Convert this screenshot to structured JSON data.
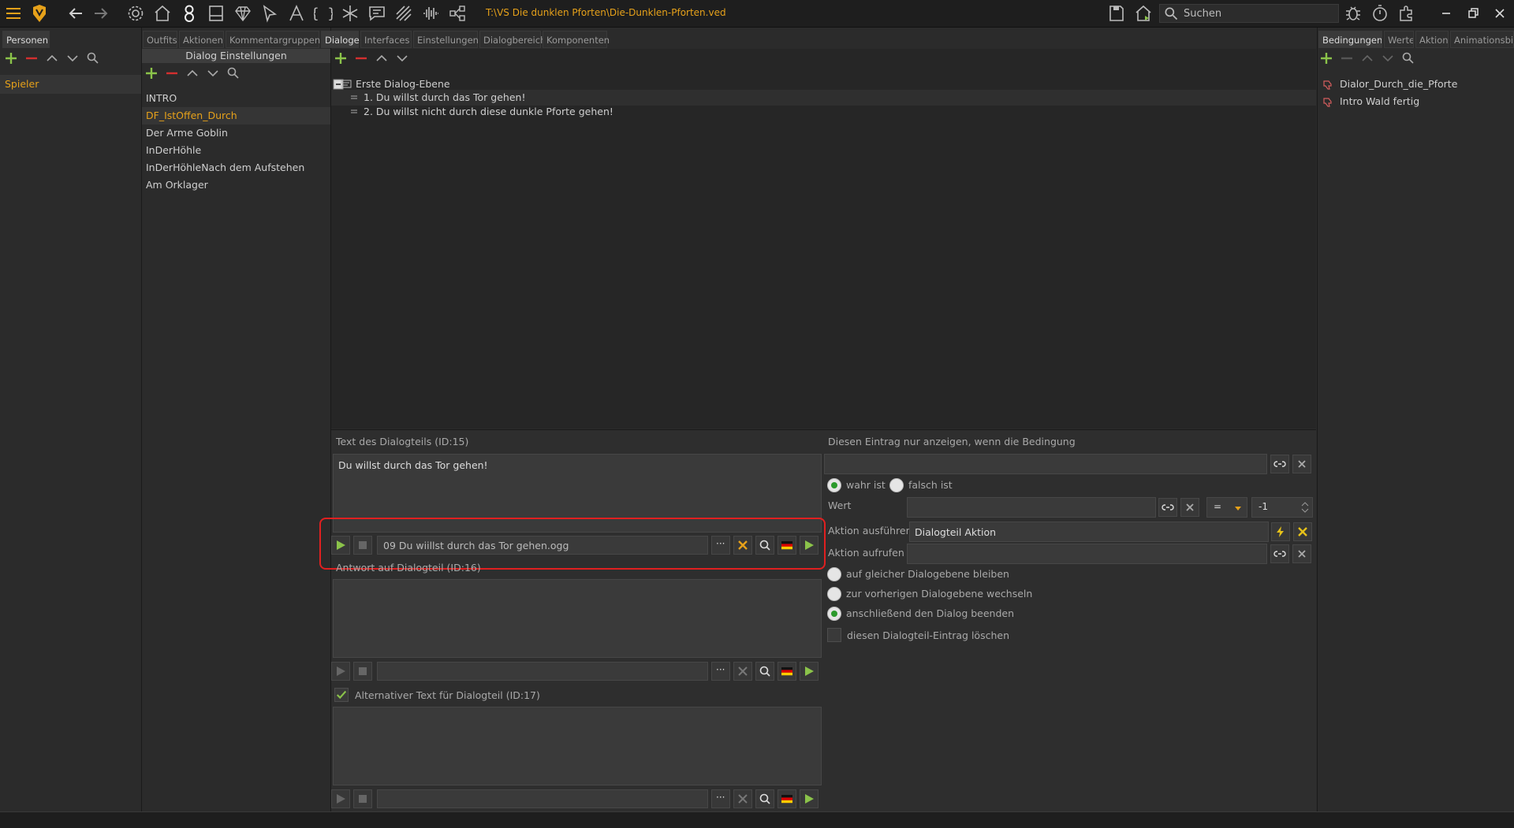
{
  "toolbar": {
    "path": "T:\\VS Die dunklen Pforten\\Die-Dunklen-Pforten.ved",
    "search_placeholder": "Suchen"
  },
  "left_panel": {
    "tab": "Personen",
    "items": [
      "Spieler"
    ]
  },
  "center_tabs": [
    "Outfits",
    "Aktionen",
    "Kommentargruppen",
    "Dialoge",
    "Interfaces",
    "Einstellungen",
    "Dialogbereich",
    "Komponenten"
  ],
  "active_center_tab": "Dialoge",
  "dialog_list": {
    "header": "Dialog Einstellungen",
    "items": [
      "INTRO",
      "DF_IstOffen_Durch",
      "Der Arme Goblin",
      "InDerHöhle",
      "InDerHöhleNach dem Aufstehen",
      "Am Orklager"
    ],
    "selected_index": 1
  },
  "tree": {
    "root": "Erste Dialog-Ebene",
    "children": [
      "1. Du willst durch das Tor gehen!",
      "2. Du willst nicht durch diese dunkle Pforte gehen!"
    ]
  },
  "editor": {
    "text_label": "Text des Dialogteils (ID:15)",
    "text_value": "Du willst durch das Tor gehen!",
    "audio_file": "09 Du wiillst durch das Tor gehen.ogg",
    "answer_label": "Antwort auf Dialogteil (ID:16)",
    "alt_label": "Alternativer Text für Dialogteil (ID:17)",
    "ellipsis": "···"
  },
  "condition": {
    "header": "Diesen Eintrag nur anzeigen, wenn die Bedingung",
    "true_label": "wahr ist",
    "false_label": "falsch ist",
    "value_label": "Wert",
    "operator": "=",
    "number": "-1",
    "execute_label": "Aktion ausführen",
    "execute_value": "Dialogteil Aktion",
    "call_label": "Aktion aufrufen",
    "options": [
      "auf gleicher Dialogebene bleiben",
      "zur vorherigen Dialogebene wechseln",
      "anschließend den Dialog beenden"
    ],
    "selected_option": 2,
    "delete_label": "diesen Dialogteil-Eintrag löschen"
  },
  "right_tabs": [
    "Bedingungen",
    "Werte",
    "Aktion",
    "Animationsbil"
  ],
  "conditions_list": [
    "Dialor_Durch_die_Pforte",
    "Intro Wald fertig"
  ],
  "colors": {
    "accent": "#e6a11a",
    "green": "#8bc34a",
    "red": "#d32f2f",
    "highlight_box": "#e02020"
  }
}
